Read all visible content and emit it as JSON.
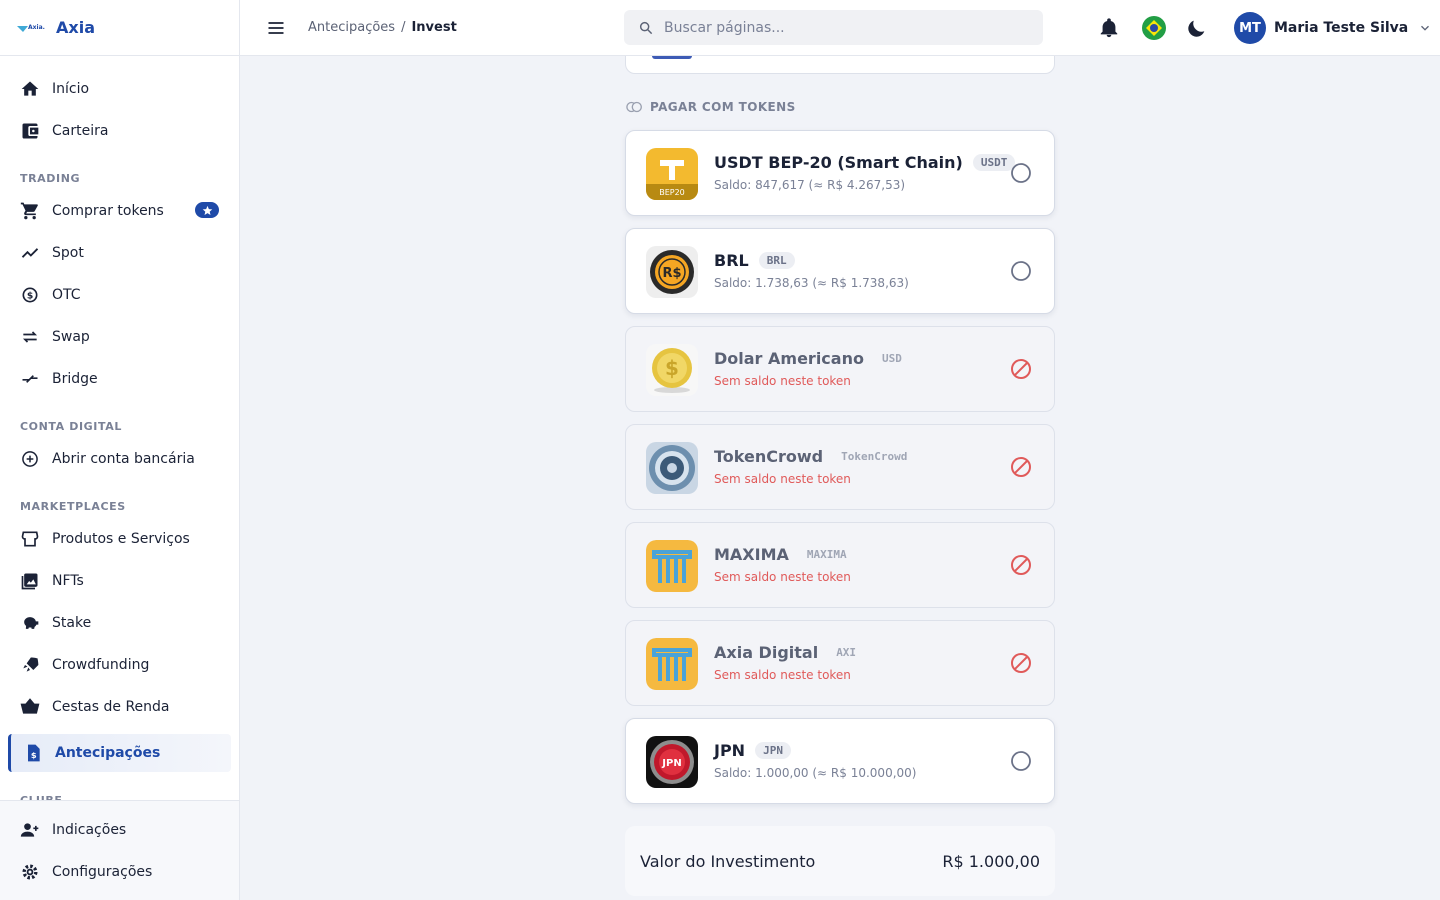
{
  "brand": {
    "name": "Axia",
    "mark_text": "Axia."
  },
  "sidebar": {
    "items_top": [
      {
        "label": "Início",
        "icon": "home-icon"
      },
      {
        "label": "Carteira",
        "icon": "wallet-icon"
      }
    ],
    "trading_title": "TRADING",
    "trading": [
      {
        "label": "Comprar tokens",
        "icon": "cart-icon"
      },
      {
        "label": "Spot",
        "icon": "chart-line-icon"
      },
      {
        "label": "OTC",
        "icon": "currency-exchange-icon"
      },
      {
        "label": "Swap",
        "icon": "swap-icon"
      },
      {
        "label": "Bridge",
        "icon": "bridge-icon"
      }
    ],
    "conta_title": "CONTA DIGITAL",
    "conta": [
      {
        "label": "Abrir conta bancária",
        "icon": "plus-circle-icon"
      }
    ],
    "market_title": "MARKETPLACES",
    "market": [
      {
        "label": "Produtos e Serviços",
        "icon": "store-icon"
      },
      {
        "label": "NFTs",
        "icon": "image-icon"
      },
      {
        "label": "Stake",
        "icon": "piggy-bank-icon"
      },
      {
        "label": "Crowdfunding",
        "icon": "rocket-icon"
      },
      {
        "label": "Cestas de Renda",
        "icon": "basket-icon"
      },
      {
        "label": "Antecipações",
        "icon": "receipt-icon"
      }
    ],
    "clube_title": "CLUBE",
    "bottom": [
      {
        "label": "Indicações",
        "icon": "add-user-icon"
      },
      {
        "label": "Configurações",
        "icon": "gear-icon"
      }
    ]
  },
  "topbar": {
    "breadcrumb": [
      "Antecipações",
      "/",
      "Invest"
    ],
    "search_placeholder": "Buscar páginas...",
    "user_initials": "MT",
    "user_name": "Maria Teste Silva"
  },
  "main": {
    "section_title": "PAGAR COM TOKENS",
    "tokens": [
      {
        "name": "USDT BEP-20 (Smart Chain)",
        "code": "USDT",
        "sub": "Saldo: 847,617 (≈ R$ 4.267,53)",
        "available": true,
        "icon": "usdt-bep20-icon",
        "icon_label": "BEP20"
      },
      {
        "name": "BRL",
        "code": "BRL",
        "sub": "Saldo: 1.738,63 (≈ R$ 1.738,63)",
        "available": true,
        "icon": "brl-coin-icon",
        "icon_label": "R$"
      },
      {
        "name": "Dolar Americano",
        "code": "USD",
        "sub": "Sem saldo neste token",
        "available": false,
        "icon": "usd-coin-icon",
        "icon_label": "$"
      },
      {
        "name": "TokenCrowd",
        "code": "TokenCrowd",
        "sub": "Sem saldo neste token",
        "available": false,
        "icon": "tokencrowd-icon"
      },
      {
        "name": "MAXIMA",
        "code": "MAXIMA",
        "sub": "Sem saldo neste token",
        "available": false,
        "icon": "maxima-icon"
      },
      {
        "name": "Axia Digital",
        "code": "AXI",
        "sub": "Sem saldo neste token",
        "available": false,
        "icon": "axia-digital-icon"
      },
      {
        "name": "JPN",
        "code": "JPN",
        "sub": "Saldo: 1.000,00 (≈ R$ 10.000,00)",
        "available": true,
        "icon": "jpn-icon",
        "icon_label": "JPN"
      }
    ],
    "summary_label": "Valor do Investimento",
    "summary_value": "R$ 1.000,00"
  },
  "colors": {
    "accent": "#1f4aa8",
    "danger": "#e05a5a",
    "muted": "#7a8196"
  }
}
